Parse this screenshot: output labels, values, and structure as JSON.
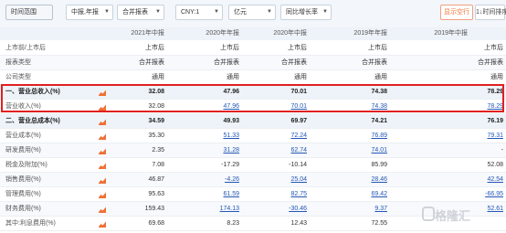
{
  "toolbar": {
    "time_range": "时间范围",
    "report_period": "中报,年报",
    "statement_type": "合并报表",
    "currency": "CNY:1",
    "unit": "亿元",
    "growth": "同比增长率",
    "blank_rows_button": "显示空行",
    "time_sort_button": "1↓时间排序"
  },
  "columns": [
    "2021年中报",
    "2020年年报",
    "2020年中报",
    "2019年年报",
    "2019年中报"
  ],
  "rows": [
    {
      "label": "上市前/上市后",
      "type": "sub",
      "values": [
        "上市后",
        "上市后",
        "上市后",
        "上市后",
        "上市后"
      ],
      "styles": [
        "plain",
        "plain",
        "plain",
        "plain",
        "plain"
      ]
    },
    {
      "label": "报表类型",
      "type": "sub",
      "values": [
        "合并报表",
        "合并报表",
        "合并报表",
        "合并报表",
        "合并报表"
      ],
      "styles": [
        "plain",
        "plain",
        "plain",
        "plain",
        "plain"
      ]
    },
    {
      "label": "公司类型",
      "type": "sub",
      "values": [
        "通用",
        "通用",
        "通用",
        "通用",
        "通用"
      ],
      "styles": [
        "plain",
        "plain",
        "plain",
        "plain",
        "plain"
      ]
    },
    {
      "label": "一、营业总收入(%)",
      "type": "section",
      "icon": true,
      "values": [
        "32.08",
        "47.96",
        "70.01",
        "74.38",
        "78.29"
      ],
      "styles": [
        "bold",
        "bold",
        "bold",
        "bold",
        "bold"
      ]
    },
    {
      "label": "营业收入(%)",
      "type": "item",
      "icon": true,
      "values": [
        "32.08",
        "47.96",
        "70.01",
        "74.38",
        "78.29"
      ],
      "styles": [
        "plain",
        "link",
        "link",
        "link",
        "link"
      ]
    },
    {
      "label": "二、营业总成本(%)",
      "type": "section",
      "icon": true,
      "values": [
        "34.59",
        "49.93",
        "69.97",
        "74.21",
        "76.19"
      ],
      "styles": [
        "bold",
        "bold",
        "bold",
        "bold",
        "bold"
      ]
    },
    {
      "label": "营业成本(%)",
      "type": "item",
      "icon": true,
      "values": [
        "35.30",
        "51.33",
        "72.24",
        "76.89",
        "79.31"
      ],
      "styles": [
        "plain",
        "link",
        "link",
        "link",
        "link"
      ]
    },
    {
      "label": "研发费用(%)",
      "type": "item",
      "icon": true,
      "values": [
        "2.35",
        "31.28",
        "62.74",
        "74.01",
        "-"
      ],
      "styles": [
        "plain",
        "link",
        "link",
        "link",
        "plain"
      ]
    },
    {
      "label": "税金及附加(%)",
      "type": "item",
      "icon": true,
      "values": [
        "7.08",
        "-17.29",
        "-10.14",
        "85.99",
        "52.08"
      ],
      "styles": [
        "plain",
        "plain",
        "plain",
        "plain",
        "plain"
      ]
    },
    {
      "label": "销售费用(%)",
      "type": "item",
      "icon": true,
      "values": [
        "46.87",
        "-4.26",
        "25.04",
        "28.46",
        "42.54"
      ],
      "styles": [
        "plain",
        "link",
        "link",
        "link",
        "link"
      ]
    },
    {
      "label": "管理费用(%)",
      "type": "item",
      "icon": true,
      "values": [
        "95.63",
        "61.59",
        "82.75",
        "69.42",
        "-66.95"
      ],
      "styles": [
        "plain",
        "link",
        "link",
        "link",
        "link"
      ]
    },
    {
      "label": "财务费用(%)",
      "type": "item",
      "icon": true,
      "values": [
        "159.43",
        "174.13",
        "-30.46",
        "9.37",
        "52.61"
      ],
      "styles": [
        "plain",
        "link",
        "link",
        "link",
        "link"
      ]
    },
    {
      "label": "其中:利息费用(%)",
      "type": "item",
      "icon": true,
      "values": [
        "69.68",
        "8.23",
        "12.43",
        "72.55",
        ""
      ],
      "styles": [
        "plain",
        "plain",
        "plain",
        "plain",
        "plain"
      ]
    }
  ],
  "watermark": "格隆汇",
  "colors": {
    "accent": "#f07035",
    "link": "#2457b6",
    "highlight": "#e02020",
    "header_bg": "#eef3f9"
  }
}
